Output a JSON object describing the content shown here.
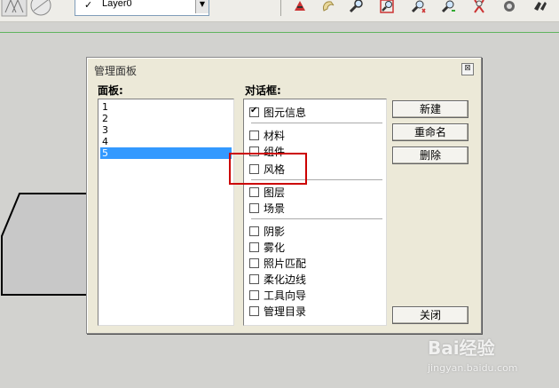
{
  "toolbar": {
    "layer_check": "✓",
    "layer_name": "Layer0",
    "dropdown_arrow": "▼",
    "icons": [
      "modeling-tool-icon",
      "orbit-icon",
      "zoom-icon",
      "zoom-window-icon",
      "zoom-extents-icon",
      "previous-view-icon",
      "next-view-icon",
      "camera-position-icon",
      "walk-icon"
    ]
  },
  "dialog": {
    "title": "管理面板",
    "close_icon": "⊠",
    "panels_label": "面板:",
    "dialogs_label": "对话框:",
    "panel_items": [
      "1",
      "2",
      "3",
      "4",
      "5"
    ],
    "selected_panel": "5",
    "dialog_groups": [
      [
        {
          "label": "图元信息",
          "checked": true
        }
      ],
      [
        {
          "label": "材料",
          "checked": false
        },
        {
          "label": "组件",
          "checked": false
        },
        {
          "label": "风格",
          "checked": false
        }
      ],
      [
        {
          "label": "图层",
          "checked": false
        },
        {
          "label": "场景",
          "checked": false
        }
      ],
      [
        {
          "label": "阴影",
          "checked": false
        },
        {
          "label": "雾化",
          "checked": false
        },
        {
          "label": "照片匹配",
          "checked": false
        },
        {
          "label": "柔化边线",
          "checked": false
        },
        {
          "label": "工具向导",
          "checked": false
        },
        {
          "label": "管理目录",
          "checked": false
        }
      ]
    ],
    "buttons": {
      "new": "新建",
      "rename": "重命名",
      "delete": "删除",
      "close": "关闭"
    }
  },
  "watermark": {
    "brand": "Bai经验",
    "url": "jingyan.baidu.com"
  },
  "colors": {
    "selection": "#3399ff",
    "highlight": "#cc0000",
    "dialog_bg": "#ece9d8",
    "axis_green": "#5fb45f"
  }
}
